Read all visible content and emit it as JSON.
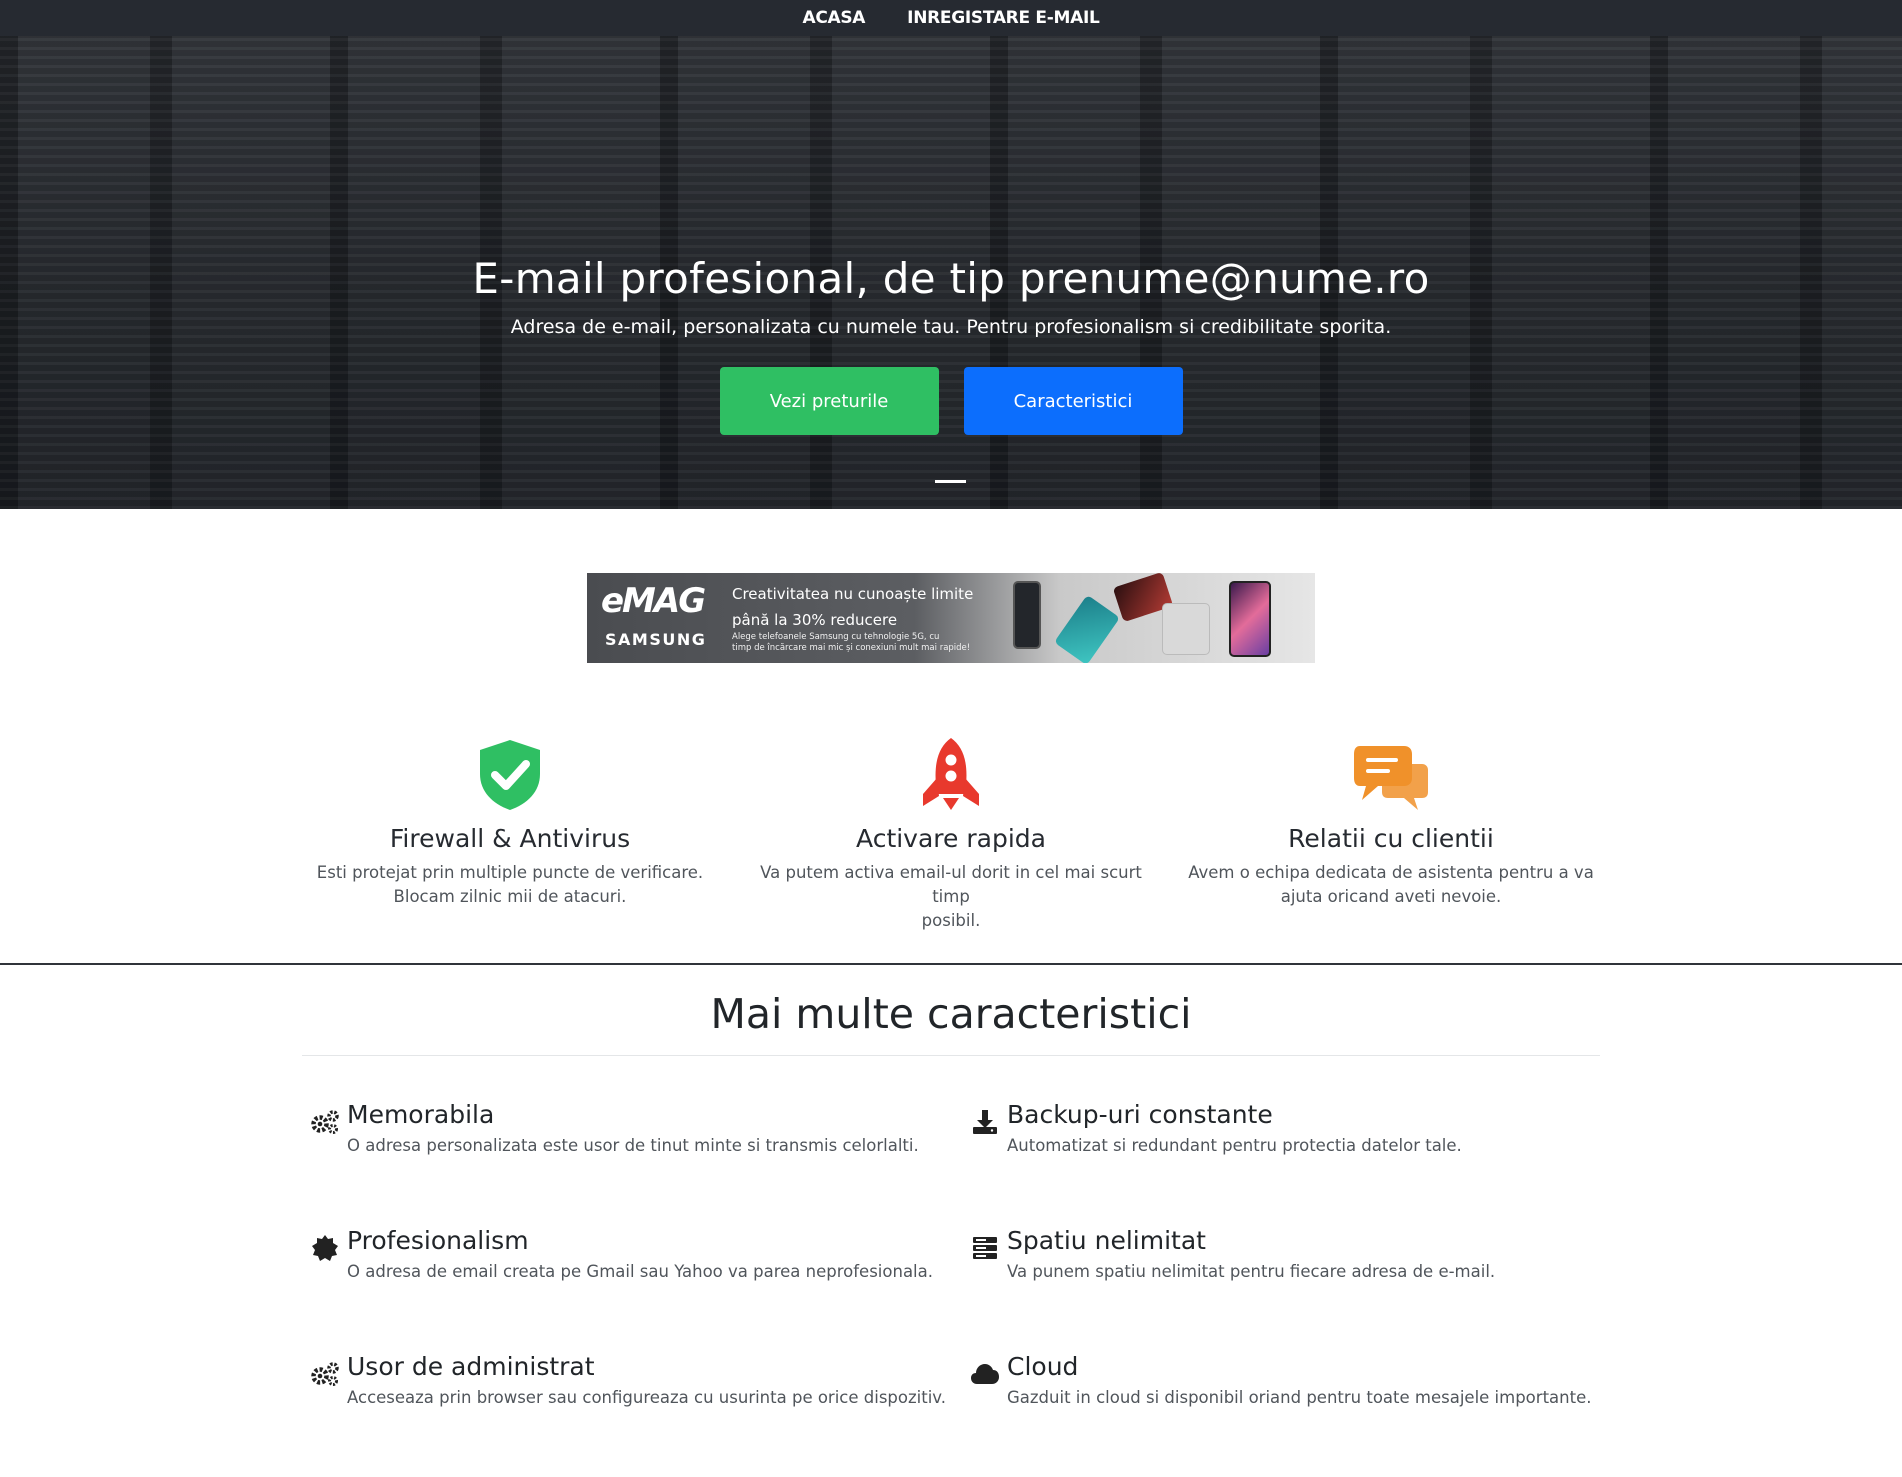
{
  "nav": {
    "items": [
      "ACASA",
      "INREGISTARE E-MAIL"
    ]
  },
  "hero": {
    "title": "E-mail profesional, de tip prenume@nume.ro",
    "subtitle": "Adresa de e-mail, personalizata cu numele tau. Pentru profesionalism si credibilitate sporita.",
    "btn_prices": "Vezi preturile",
    "btn_features": "Caracteristici"
  },
  "banner": {
    "brand": "eMAG",
    "partner": "SAMSUNG",
    "headline_1": "Creativitatea nu cunoaște limite",
    "headline_2": "până la 30% reducere",
    "fine_1": "Alege telefoanele Samsung cu tehnologie 5G, cu",
    "fine_2": "timp de încărcare mai mic și conexiuni mult mai rapide!"
  },
  "features": [
    {
      "icon": "shield-check-icon",
      "color": "#2fbf63",
      "title": "Firewall & Antivirus",
      "line1": "Esti protejat prin multiple puncte de verificare.",
      "line2": "Blocam zilnic mii de atacuri."
    },
    {
      "icon": "rocket-icon",
      "color": "#e8392d",
      "title": "Activare rapida",
      "line1": "Va putem activa email-ul dorit in cel mai scurt timp",
      "line2": "posibil."
    },
    {
      "icon": "chat-bubbles-icon",
      "color": "#f0912a",
      "title": "Relatii cu clientii",
      "line1": "Avem o echipa dedicata de asistenta pentru a va",
      "line2": "ajuta oricand aveti nevoie."
    }
  ],
  "more": {
    "title": "Mai multe caracteristici",
    "items": [
      {
        "icon": "gears-icon",
        "title": "Memorabila",
        "text": "O adresa personalizata este usor de tinut minte si transmis celorlalti."
      },
      {
        "icon": "download-icon",
        "title": "Backup-uri constante",
        "text": "Automatizat si redundant pentru protectia datelor tale."
      },
      {
        "icon": "certificate-icon",
        "title": "Profesionalism",
        "text": "O adresa de email creata pe Gmail sau Yahoo va parea neprofesionala."
      },
      {
        "icon": "server-icon",
        "title": "Spatiu nelimitat",
        "text": "Va punem spatiu nelimitat pentru fiecare adresa de e-mail."
      },
      {
        "icon": "gears-icon",
        "title": "Usor de administrat",
        "text": "Acceseaza prin browser sau configureaza cu usurinta pe orice dispozitiv."
      },
      {
        "icon": "cloud-icon",
        "title": "Cloud",
        "text": "Gazduit in cloud si disponibil oriand pentru toate mesajele importante."
      }
    ]
  }
}
